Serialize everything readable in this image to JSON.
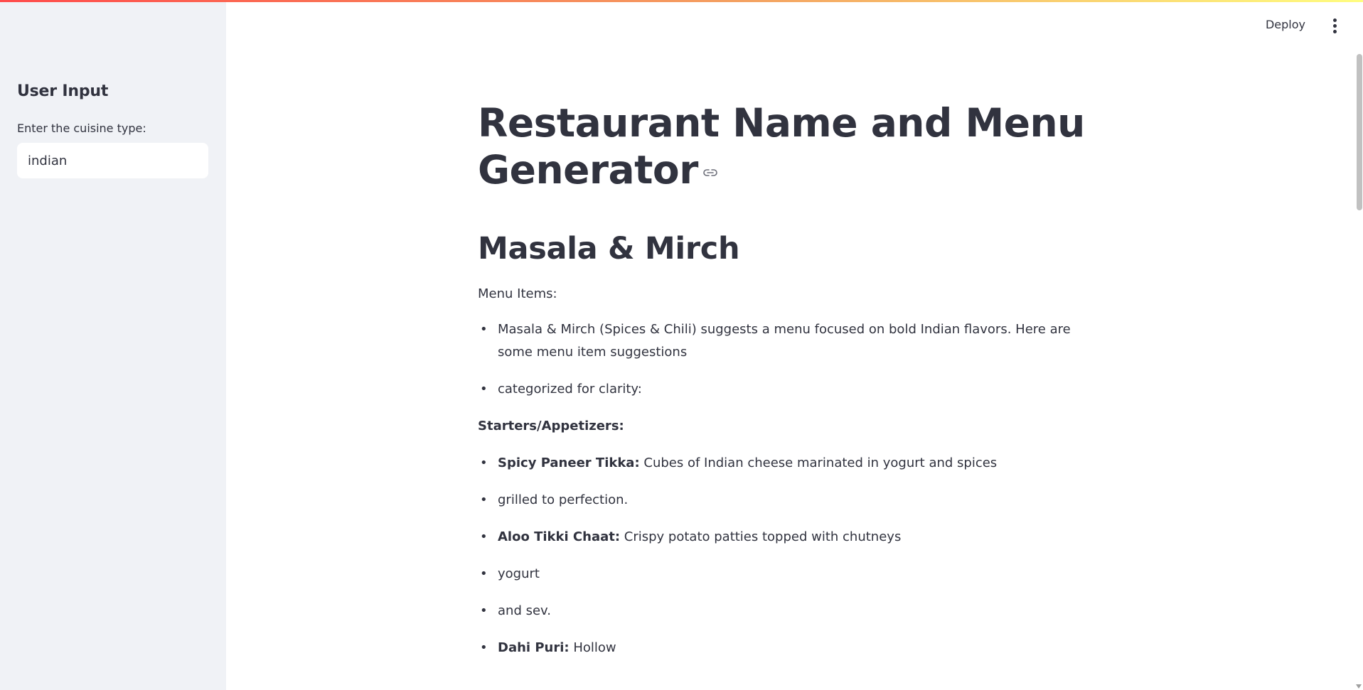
{
  "colors": {
    "sidebar_bg": "#f0f2f6",
    "text": "#31333f",
    "accent": "#ff4b4b"
  },
  "sidebar": {
    "heading": "User Input",
    "input_label": "Enter the cuisine type:",
    "input_value": "indian"
  },
  "header": {
    "deploy_label": "Deploy",
    "menu_icon": "vertical-ellipsis-icon"
  },
  "main": {
    "title": "Restaurant Name and Menu Generator",
    "restaurant_name": "Masala & Mirch",
    "menu_label": "Menu Items:",
    "intro_items": [
      "Masala & Mirch (Spices & Chili) suggests a menu focused on bold Indian flavors. Here are some menu item suggestions",
      "categorized for clarity:"
    ],
    "section_heading": "Starters/Appetizers:",
    "items": [
      {
        "bold": "Spicy Paneer Tikka:",
        "text": " Cubes of Indian cheese marinated in yogurt and spices"
      },
      {
        "bold": "",
        "text": "grilled to perfection."
      },
      {
        "bold": "Aloo Tikki Chaat:",
        "text": " Crispy potato patties topped with chutneys"
      },
      {
        "bold": "",
        "text": "yogurt"
      },
      {
        "bold": "",
        "text": "and sev."
      },
      {
        "bold": "Dahi Puri:",
        "text": " Hollow"
      }
    ]
  }
}
